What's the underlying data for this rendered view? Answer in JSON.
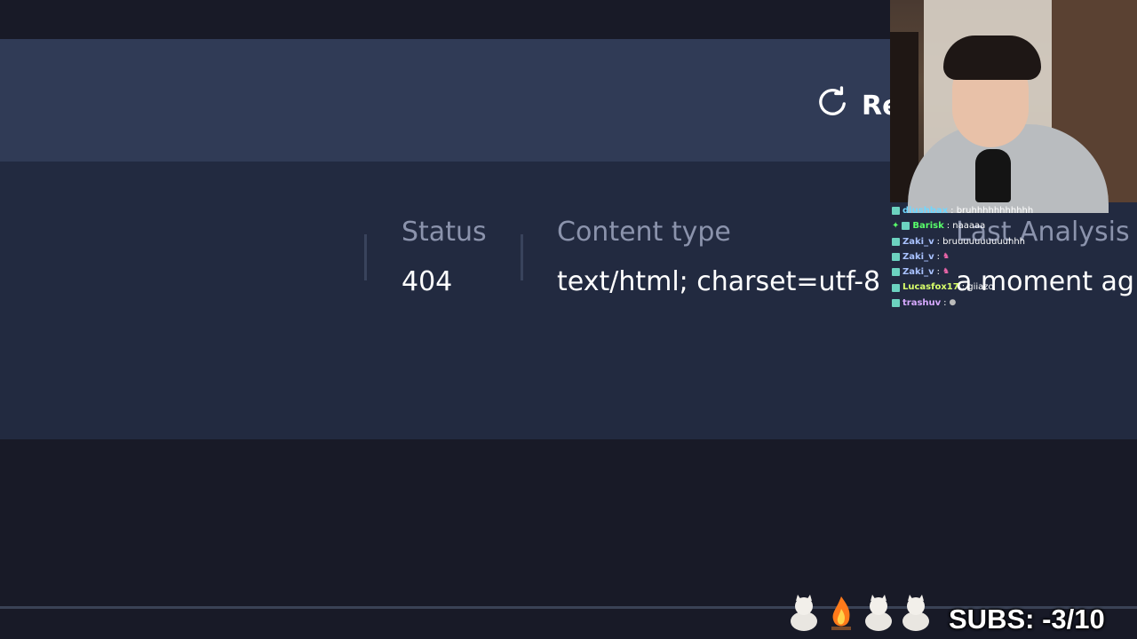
{
  "header": {
    "reanalyze_label": "Re"
  },
  "meta": {
    "status_label": "Status",
    "status_value": "404",
    "content_type_label": "Content type",
    "content_type_value": "text/html; charset=utf-8",
    "last_analysis_label": "Last Analysis",
    "last_analysis_value": "a moment ag"
  },
  "chat": {
    "messages": [
      {
        "user": "diushbax",
        "text": ": bruhhhhhhhhhhh",
        "color": "#6fd7ff"
      },
      {
        "user": "Barisk",
        "text": ": naaaaa",
        "color": "#58ff6a"
      },
      {
        "user": "Zaki_v",
        "text": ": bruuuuuuuuuuhhh",
        "color": "#a9c2ff"
      },
      {
        "user": "Zaki_v",
        "text": ":",
        "color": "#a9c2ff"
      },
      {
        "user": "Zaki_v",
        "text": ":",
        "color": "#a9c2ff"
      },
      {
        "user": "Lucasfox17",
        "text": ": giiazo",
        "color": "#d8ff6a"
      },
      {
        "user": "trashuv",
        "text": ":",
        "color": "#d7a9ff"
      }
    ]
  },
  "overlay": {
    "subs_text": "SUBS: -3/10"
  },
  "colors": {
    "background": "#181a27",
    "header_band": "#303b56",
    "meta_panel": "#222a40",
    "label": "#8b93ac"
  }
}
